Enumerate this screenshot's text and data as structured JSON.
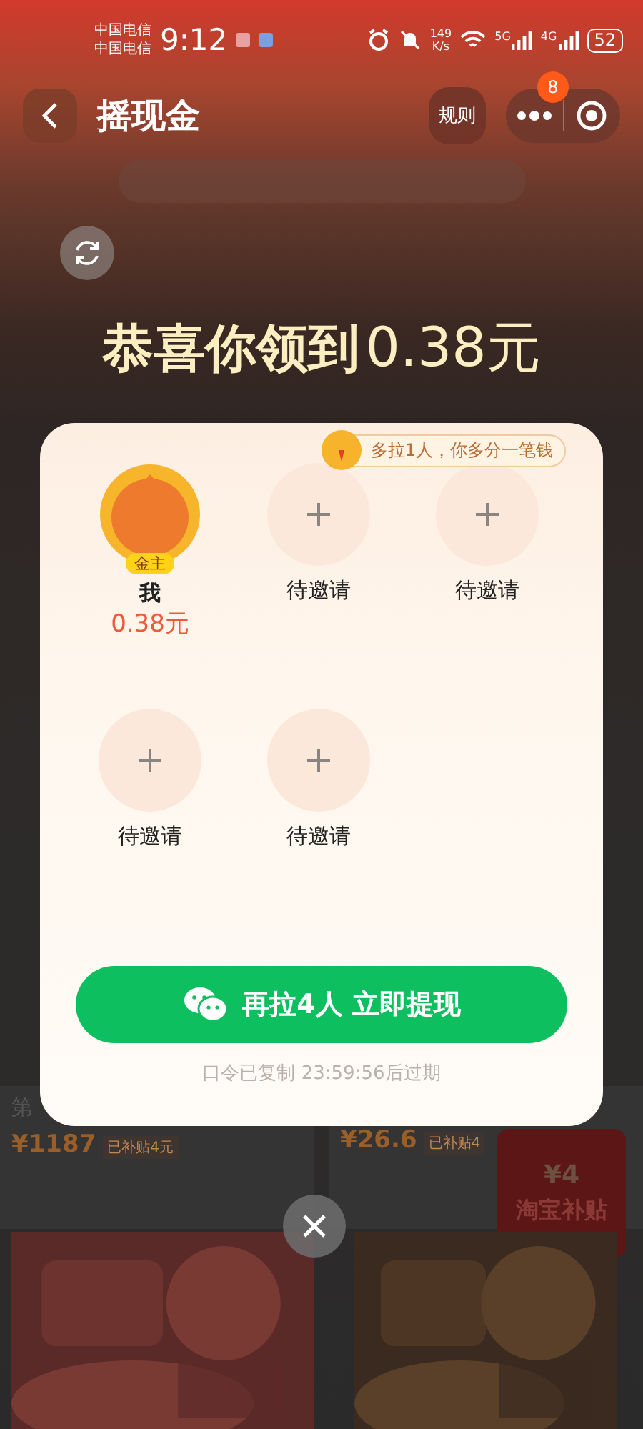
{
  "status_bar": {
    "carriers": [
      "中国电信",
      "中国电信"
    ],
    "time": "9:12",
    "speed": "149",
    "speed_unit": "K/s",
    "networks": [
      "5G",
      "4G"
    ],
    "battery": "52"
  },
  "nav": {
    "title": "摇现金",
    "rules_button": "规则",
    "badge": "8"
  },
  "headline": {
    "text": "恭喜你领到",
    "amount": "0.38元"
  },
  "modal": {
    "tip": "多拉1人，你多分一笔钱",
    "slots": [
      {
        "kind": "member",
        "tag": "金主",
        "name": "我",
        "amount": "0.38元"
      },
      {
        "kind": "empty",
        "label": "待邀请"
      },
      {
        "kind": "empty",
        "label": "待邀请"
      },
      {
        "kind": "empty",
        "label": "待邀请"
      },
      {
        "kind": "empty",
        "label": "待邀请"
      }
    ],
    "button": "再拉4人 立即提现",
    "footer": "口令已复制 23:59:56后过期"
  },
  "products": [
    {
      "title": "第",
      "price": "¥1187",
      "subsidy": "已补贴4元"
    },
    {
      "price": "¥26.6",
      "subsidy": "已补贴4"
    }
  ],
  "promo": {
    "price": "¥4",
    "label": "淘宝补贴"
  }
}
